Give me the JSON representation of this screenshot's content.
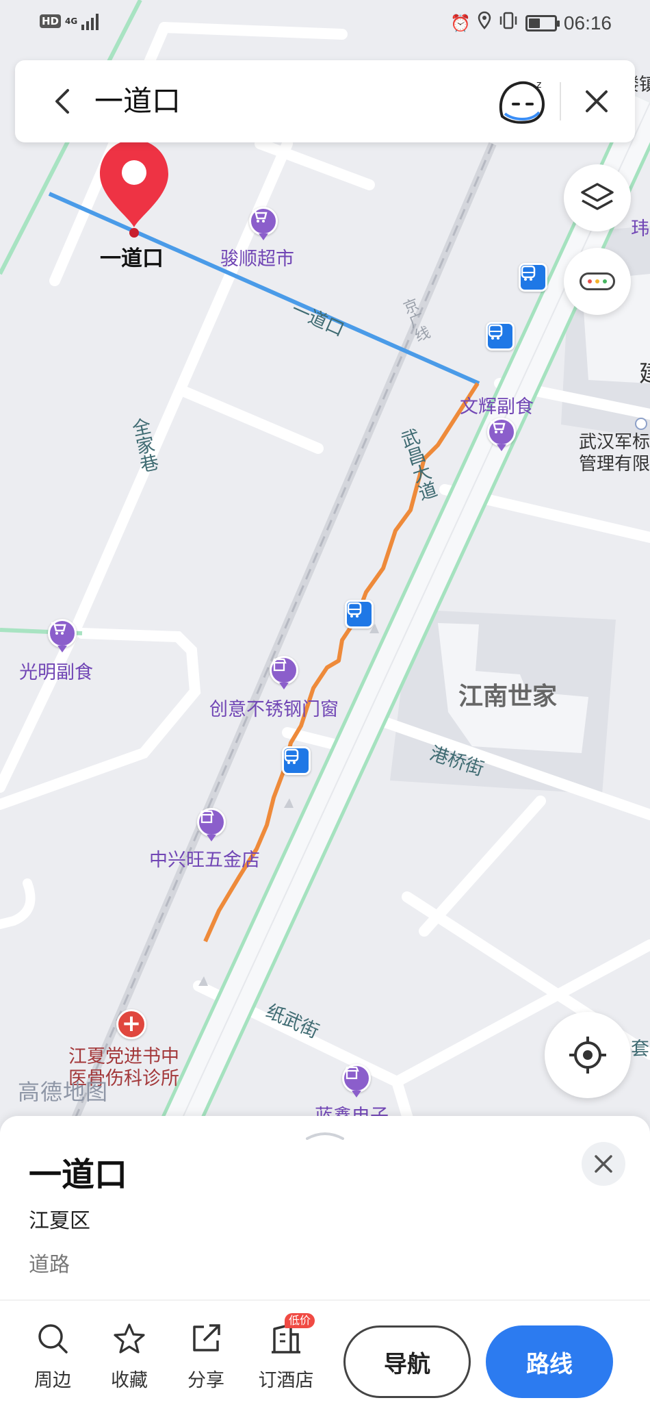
{
  "status_bar": {
    "hd": "HD",
    "network": "4G",
    "time": "06:16",
    "battery_level": 0.45,
    "icons": [
      "alarm-icon",
      "location-icon",
      "vibrate-icon",
      "battery-icon"
    ]
  },
  "search": {
    "query": "一道口",
    "icons": [
      "back-icon",
      "assistant-icon",
      "close-icon"
    ]
  },
  "map": {
    "selected_road_color": "#4a9be8",
    "track_color": "#ee8a3a",
    "labels": {
      "pin": "一道口",
      "road_yidaokou": "一道口",
      "quanjiaxiang": "全家巷",
      "wuchang_avenue": "武昌大道",
      "jingguang_line": "京广线",
      "gangqiao_street": "港桥街",
      "zhiwu_street": "纸武街",
      "junshun": "骏顺超市",
      "wenhui": "文辉副食",
      "guangming": "光明副食",
      "chuangyi": "创意不锈钢门窗",
      "zhongxingwang": "中兴旺五金店",
      "jiangnan": "江南世家",
      "military_line1": "武汉军标",
      "military_line2": "管理有限",
      "clinic_line1": "江夏党进书中",
      "clinic_line2": "医骨伤科诊所",
      "landian": "蓝鑫电子",
      "edge_top": "楼镇",
      "edge_wei": "玮",
      "edge_jian": "建",
      "edge_tao": "套"
    },
    "watermark": "高德地图"
  },
  "card": {
    "title": "一道口",
    "district": "江夏区",
    "type": "道路"
  },
  "actions": {
    "nearby": "周边",
    "favorite": "收藏",
    "share": "分享",
    "hotel": "订酒店",
    "hotel_badge": "低价",
    "navigate": "导航",
    "route": "路线"
  }
}
